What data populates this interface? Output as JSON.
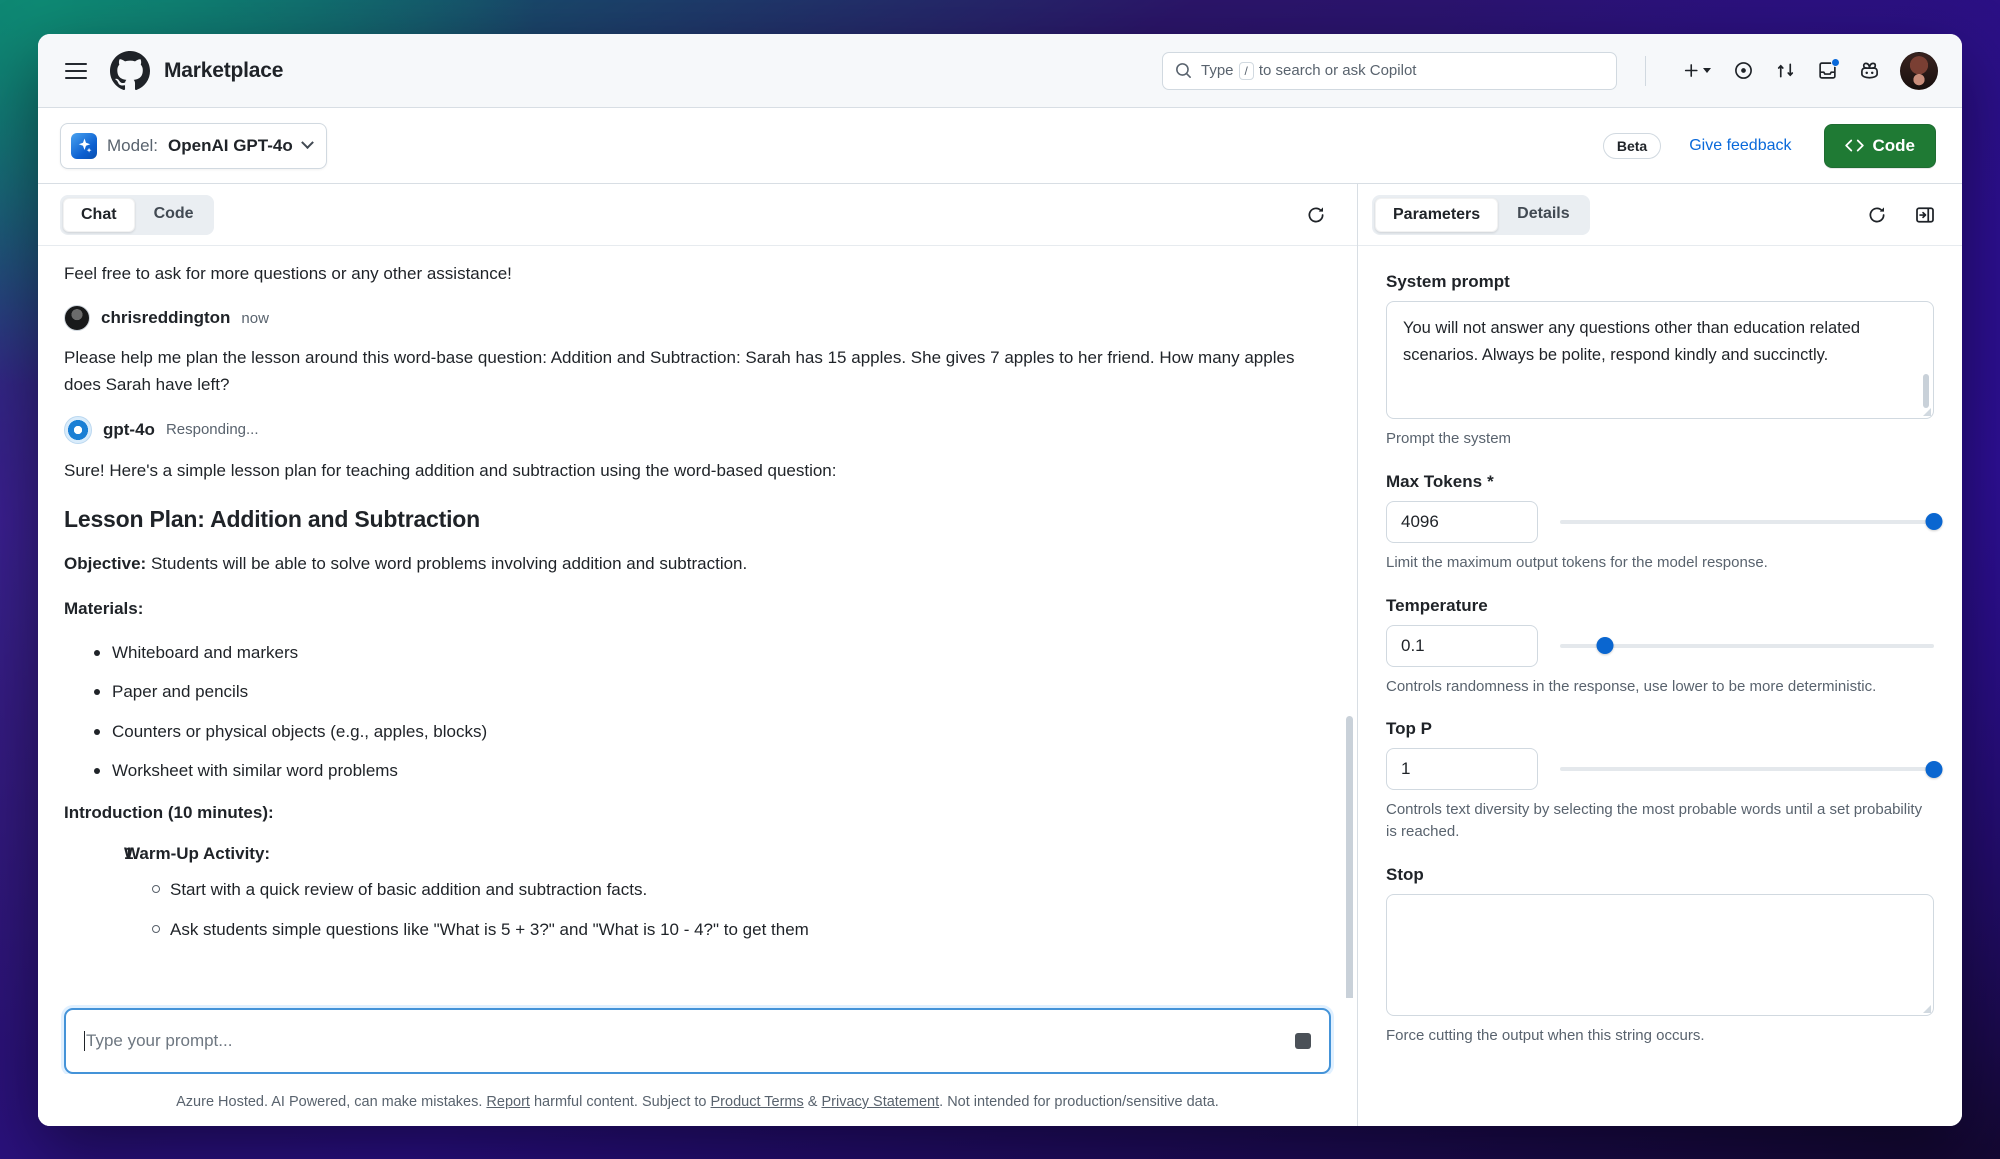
{
  "header": {
    "menu_icon": "hamburger-icon",
    "logo_icon": "github-logo-icon",
    "title": "Marketplace",
    "search": {
      "placeholder_prefix": "Type",
      "slash_key": "/",
      "placeholder_suffix": "to search or ask Copilot",
      "icon": "search-icon"
    },
    "actions": [
      {
        "name": "create-new",
        "icon": "plus-icon"
      },
      {
        "name": "issues",
        "icon": "issue-opened-icon"
      },
      {
        "name": "pull-requests",
        "icon": "git-pull-request-icon"
      },
      {
        "name": "inbox",
        "icon": "inbox-icon",
        "has_notification": true
      },
      {
        "name": "copilot",
        "icon": "copilot-icon"
      }
    ],
    "avatar": "user-avatar"
  },
  "model_bar": {
    "icon": "model-sparkle-icon",
    "label": "Model:",
    "name": "OpenAI GPT-4o",
    "chevron": "chevron-down-icon",
    "beta_badge": "Beta",
    "feedback_link": "Give feedback",
    "code_button": "Code",
    "code_icon": "code-brackets-icon",
    "accent_green": "#1f7a34",
    "link_blue": "#0969da"
  },
  "chat": {
    "tabs": [
      {
        "label": "Chat",
        "active": true
      },
      {
        "label": "Code",
        "active": false
      }
    ],
    "refresh_icon": "refresh-icon",
    "messages": {
      "prior_line": "Feel free to ask for more questions or any other assistance!",
      "user": {
        "author": "chrisreddington",
        "time": "now",
        "text": "Please help me plan the lesson around this word-base question: Addition and Subtraction: Sarah has 15 apples. She gives 7 apples to her friend. How many apples does Sarah have left?"
      },
      "assistant": {
        "author": "gpt-4o",
        "status": "Responding...",
        "intro": "Sure! Here's a simple lesson plan for teaching addition and subtraction using the word-based question:",
        "heading": "Lesson Plan: Addition and Subtraction",
        "objective_label": "Objective:",
        "objective_text": "Students will be able to solve word problems involving addition and subtraction.",
        "materials_label": "Materials:",
        "materials": [
          "Whiteboard and markers",
          "Paper and pencils",
          "Counters or physical objects (e.g., apples, blocks)",
          "Worksheet with similar word problems"
        ],
        "introduction_label": "Introduction (10 minutes):",
        "steps": [
          {
            "title": "Warm-Up Activity:",
            "items": [
              "Start with a quick review of basic addition and subtraction facts.",
              "Ask students simple questions like \"What is 5 + 3?\" and \"What is 10 - 4?\" to get them"
            ]
          }
        ]
      }
    },
    "composer": {
      "placeholder": "Type your prompt...",
      "send_icon": "send-stop-icon"
    },
    "footer": {
      "part1": "Azure Hosted. AI Powered, can make mistakes.",
      "link1": "Report",
      "part2": "harmful content. Subject to",
      "link2": "Product Terms",
      "amp": "&",
      "link3": "Privacy Statement",
      "part3": ". Not intended for production/sensitive data."
    }
  },
  "parameters": {
    "tabs": [
      {
        "label": "Parameters",
        "active": true
      },
      {
        "label": "Details",
        "active": false
      }
    ],
    "refresh_icon": "refresh-icon",
    "collapse_icon": "sidebar-collapse-icon",
    "fields": [
      {
        "name": "system-prompt",
        "label": "System prompt",
        "value": "You will not answer any questions other than education related scenarios. Always be polite, respond kindly and succinctly.",
        "help": "Prompt the system"
      },
      {
        "name": "max-tokens",
        "label": "Max Tokens",
        "required": "*",
        "value": "4096",
        "slider_percent": 100,
        "help": "Limit the maximum output tokens for the model response."
      },
      {
        "name": "temperature",
        "label": "Temperature",
        "value": "0.1",
        "slider_percent": 12,
        "help": "Controls randomness in the response, use lower to be more deterministic."
      },
      {
        "name": "top-p",
        "label": "Top P",
        "value": "1",
        "slider_percent": 100,
        "help": "Controls text diversity by selecting the most probable words until a set probability is reached."
      },
      {
        "name": "stop",
        "label": "Stop",
        "value": "",
        "help": "Force cutting the output when this string occurs."
      }
    ],
    "slider_accent": "#0a66d0"
  }
}
